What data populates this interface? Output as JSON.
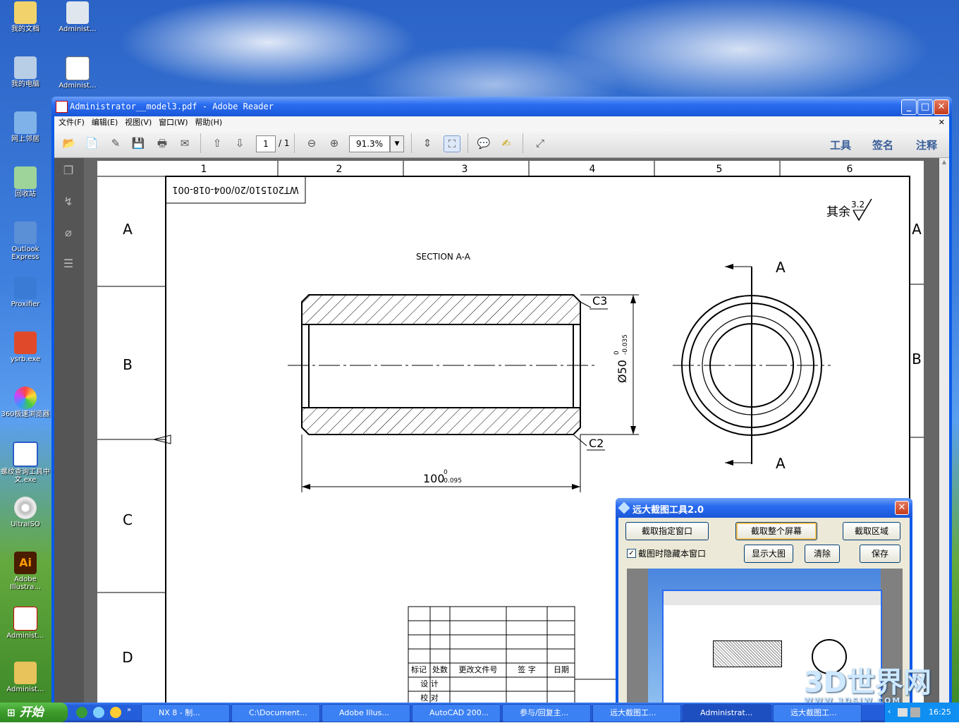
{
  "desktop": {
    "icons_left": [
      {
        "label": "我的文档",
        "icon": "folder-documents-icon"
      },
      {
        "label": "我的电脑",
        "icon": "computer-icon"
      },
      {
        "label": "网上邻居",
        "icon": "network-icon"
      },
      {
        "label": "回收站",
        "icon": "recycle-bin-icon"
      },
      {
        "label": "Outlook Express",
        "icon": "outlook-icon"
      },
      {
        "label": "Proxifier",
        "icon": "proxifier-icon"
      },
      {
        "label": "ysrb.exe",
        "icon": "ietv-icon"
      },
      {
        "label": "360极速浏览器",
        "icon": "browser-360-icon"
      },
      {
        "label": "螺纹查询工具中文.exe",
        "icon": "exe-window-icon"
      },
      {
        "label": "UltraISO",
        "icon": "ultraiso-icon"
      },
      {
        "label": "Adobe Illustra...",
        "icon": "illustrator-icon"
      },
      {
        "label": "Administ...",
        "icon": "pdf-file-icon"
      },
      {
        "label": "Administ...",
        "icon": "dwg-file-icon"
      }
    ],
    "icons_second": [
      {
        "label": "Administ...",
        "icon": "eye-file-icon"
      },
      {
        "label": "Administ...",
        "icon": "doc-file-icon"
      }
    ]
  },
  "reader": {
    "title": "Administrator__model3.pdf - Adobe Reader",
    "menu": [
      "文件(F)",
      "编辑(E)",
      "视图(V)",
      "窗口(W)",
      "帮助(H)"
    ],
    "page_current": "1",
    "page_total": "/ 1",
    "zoom": "91.3%",
    "right_links": [
      "工具",
      "签名",
      "注释"
    ]
  },
  "drawing": {
    "columns": [
      "1",
      "2",
      "3",
      "4",
      "5",
      "6"
    ],
    "rows": [
      "A",
      "B",
      "C",
      "D"
    ],
    "drawing_number": "WT201510/20/004-018-001",
    "section_label": "SECTION A-A",
    "roughness_prefix": "其余",
    "roughness_value": "3.2",
    "chamfer_top": "C3",
    "chamfer_bottom": "C2",
    "diameter_dim": "Ø50",
    "diameter_tol_upper": "0",
    "diameter_tol_lower": "-0.035",
    "length_dim": "100",
    "length_tol_upper": "0",
    "length_tol_lower": "-0.095",
    "section_marker": "A",
    "title_block_headers": [
      "标记",
      "处数",
      "更改文件号",
      "签 字",
      "日期"
    ],
    "title_block_rows": [
      "设 计",
      "校 对"
    ]
  },
  "dialog": {
    "title": "远大截图工具2.0",
    "btn_window": "截取指定窗口",
    "btn_fullscreen": "截取整个屏幕",
    "btn_region": "截取区域",
    "checkbox_label": "截图时隐藏本窗口",
    "checkbox_checked": true,
    "btn_show": "显示大图",
    "btn_clear": "清除",
    "btn_save": "保存"
  },
  "taskbar": {
    "start": "开始",
    "tasks": [
      "NX 8 - 制...",
      "C:\\Document...",
      "Adobe Illus...",
      "AutoCAD 200...",
      "参与/回复主...",
      "远大截图工...",
      "Administrat...",
      "远大截图工..."
    ],
    "clock": "16:25"
  },
  "watermark": {
    "text": "3D世界网",
    "url": "WWW.3DSJW.COM"
  }
}
